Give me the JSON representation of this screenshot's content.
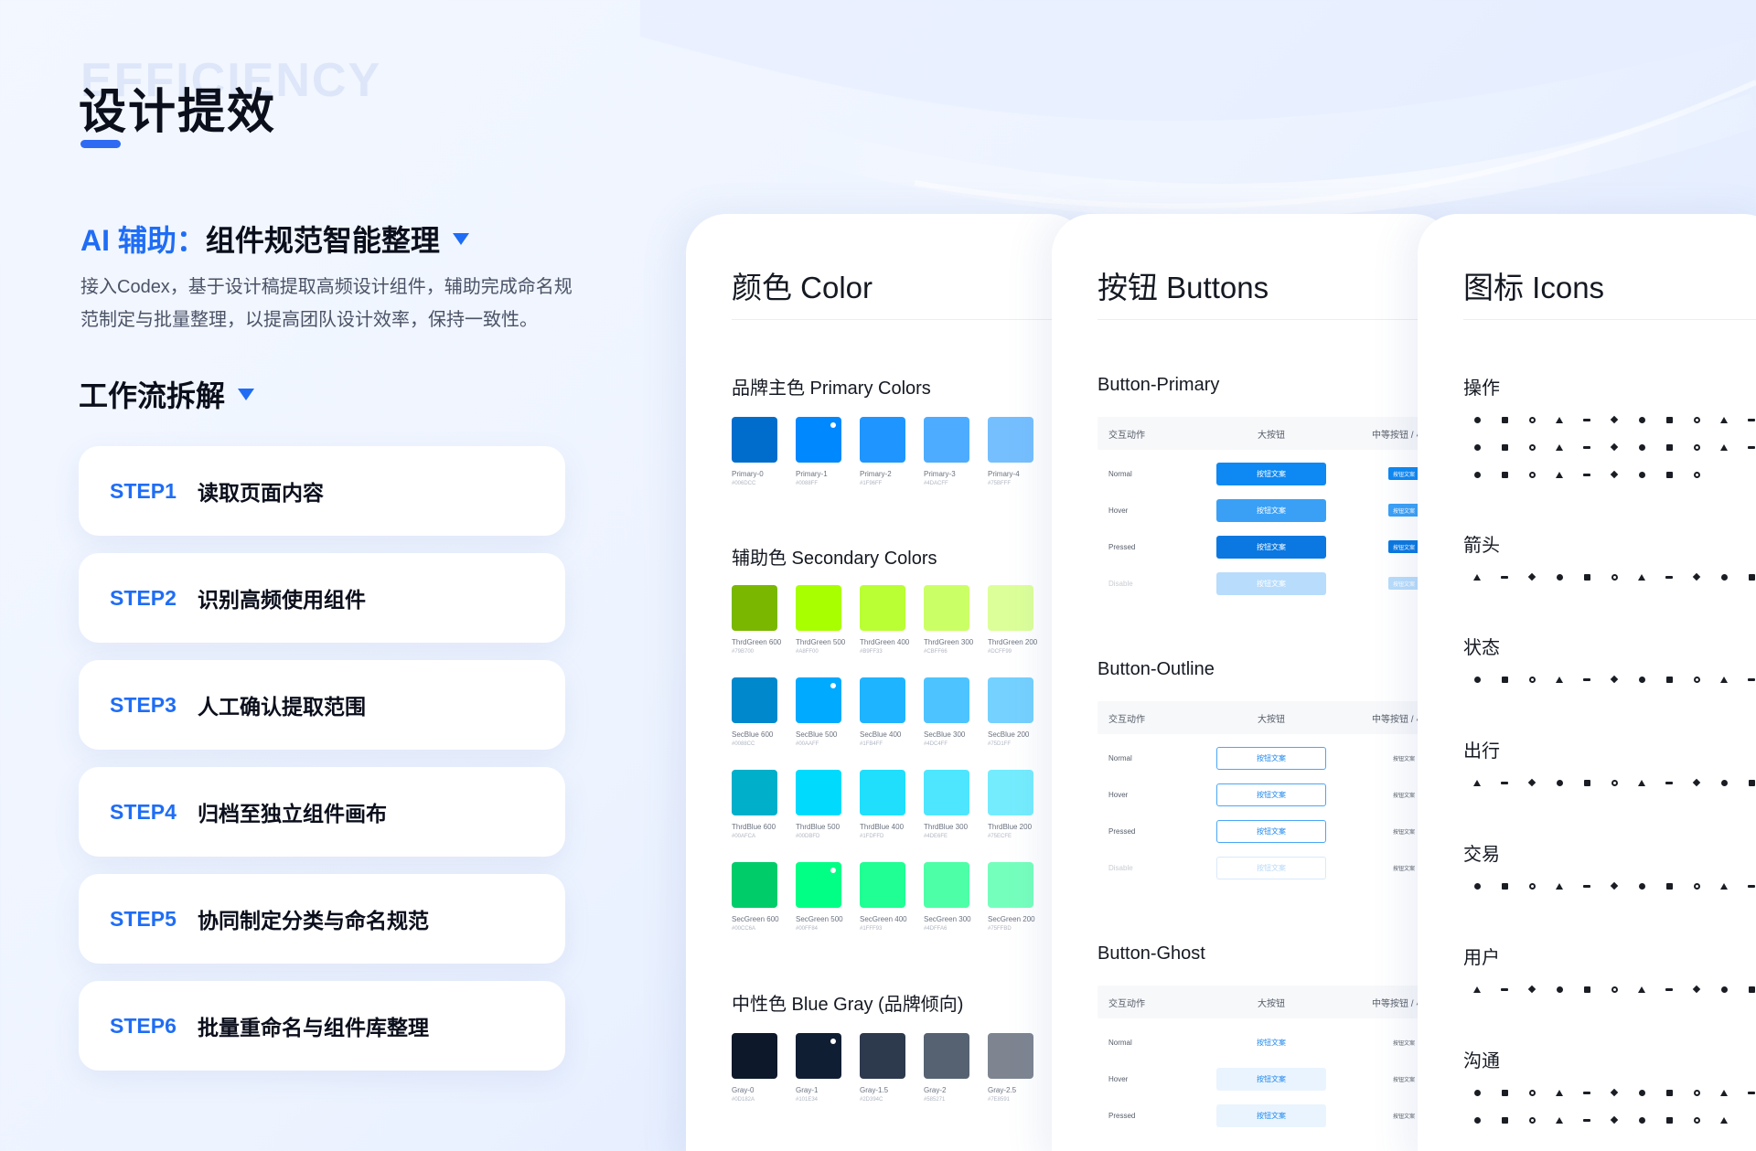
{
  "page": {
    "ghost_word": "EFFICIENCY",
    "title": "设计提效"
  },
  "section": {
    "accent": "AI 辅助：",
    "heading": "组件规范智能整理",
    "description": "接入Codex，基于设计稿提取高频设计组件，辅助完成命名规范制定与批量整理，以提高团队设计效率，保持一致性。"
  },
  "workflow": {
    "heading": "工作流拆解",
    "steps": [
      {
        "num": "STEP1",
        "text": "读取页面内容"
      },
      {
        "num": "STEP2",
        "text": "识别高频使用组件"
      },
      {
        "num": "STEP3",
        "text": "人工确认提取范围"
      },
      {
        "num": "STEP4",
        "text": "归档至独立组件画布"
      },
      {
        "num": "STEP5",
        "text": "协同制定分类与命名规范"
      },
      {
        "num": "STEP6",
        "text": "批量重命名与组件库整理"
      }
    ]
  },
  "color_panel": {
    "title": "颜色 Color",
    "primary_label": "品牌主色 Primary Colors",
    "primary": [
      {
        "name": "Primary-0",
        "hex": "#006DCC",
        "color": "#006DCC"
      },
      {
        "name": "Primary-1",
        "hex": "#0088FF",
        "color": "#0088FF",
        "marked": true
      },
      {
        "name": "Primary-2",
        "hex": "#1F96FF",
        "color": "#1F96FF"
      },
      {
        "name": "Primary-3",
        "hex": "#4DACFF",
        "color": "#4DACFF"
      },
      {
        "name": "Primary-4",
        "hex": "#75BFFF",
        "color": "#75BFFF"
      }
    ],
    "secondary_label": "辅助色 Secondary Colors",
    "secondary_rows": [
      [
        {
          "name": "ThrdGreen 600",
          "hex": "#79B700",
          "color": "#79B700"
        },
        {
          "name": "ThrdGreen 500",
          "hex": "#A8FF00",
          "color": "#A8FF00"
        },
        {
          "name": "ThrdGreen 400",
          "hex": "#B9FF33",
          "color": "#B9FF33"
        },
        {
          "name": "ThrdGreen 300",
          "hex": "#CBFF66",
          "color": "#CBFF66"
        },
        {
          "name": "ThrdGreen 200",
          "hex": "#DCFF99",
          "color": "#DCFF99"
        }
      ],
      [
        {
          "name": "SecBlue 600",
          "hex": "#0088CC",
          "color": "#0088CC"
        },
        {
          "name": "SecBlue 500",
          "hex": "#00AAFF",
          "color": "#00AAFF",
          "marked": true
        },
        {
          "name": "SecBlue 400",
          "hex": "#1FB4FF",
          "color": "#1FB4FF"
        },
        {
          "name": "SecBlue 300",
          "hex": "#4DC4FF",
          "color": "#4DC4FF"
        },
        {
          "name": "SecBlue 200",
          "hex": "#75D1FF",
          "color": "#75D1FF"
        }
      ],
      [
        {
          "name": "ThrdBlue 600",
          "hex": "#00AFCA",
          "color": "#00AFCA"
        },
        {
          "name": "ThrdBlue 500",
          "hex": "#00DBFD",
          "color": "#00DBFD"
        },
        {
          "name": "ThrdBlue 400",
          "hex": "#1FDFFD",
          "color": "#1FDFFD"
        },
        {
          "name": "ThrdBlue 300",
          "hex": "#4DE6FE",
          "color": "#4DE6FE"
        },
        {
          "name": "ThrdBlue 200",
          "hex": "#75ECFE",
          "color": "#75ECFE"
        }
      ],
      [
        {
          "name": "SecGreen 600",
          "hex": "#00CC6A",
          "color": "#00CC6A"
        },
        {
          "name": "SecGreen 500",
          "hex": "#00FF84",
          "color": "#00FF84",
          "marked": true
        },
        {
          "name": "SecGreen 400",
          "hex": "#1FFF93",
          "color": "#1FFF93"
        },
        {
          "name": "SecGreen 300",
          "hex": "#4DFFA6",
          "color": "#4DFFA6"
        },
        {
          "name": "SecGreen 200",
          "hex": "#75FFBD",
          "color": "#75FFBD"
        }
      ]
    ],
    "neutral_label": "中性色 Blue Gray (品牌倾向)",
    "neutral": [
      {
        "name": "Gray-0",
        "hex": "#0D182A",
        "color": "#0D182A"
      },
      {
        "name": "Gray-1",
        "hex": "#101E34",
        "color": "#101E34",
        "marked": true
      },
      {
        "name": "Gray-1.5",
        "hex": "#2D394C",
        "color": "#2D394C"
      },
      {
        "name": "Gray-2",
        "hex": "#585271",
        "color": "#566272"
      },
      {
        "name": "Gray-2.5",
        "hex": "#7E8591",
        "color": "#7E8591"
      }
    ]
  },
  "buttons_panel": {
    "title": "按钮 Buttons",
    "header": [
      "交互动作",
      "大按钮",
      "中等按钮 / 小"
    ],
    "btn_text": "按钮文案",
    "groups": [
      {
        "label": "Button-Primary",
        "style": "primary",
        "states": [
          "Normal",
          "Hover",
          "Pressed",
          "Disable"
        ]
      },
      {
        "label": "Button-Outline",
        "style": "outline",
        "states": [
          "Normal",
          "Hover",
          "Pressed",
          "Disable"
        ]
      },
      {
        "label": "Button-Ghost",
        "style": "ghost",
        "states": [
          "Normal",
          "Hover",
          "Pressed"
        ]
      }
    ],
    "colors": {
      "primary_normal": "#0E88F2",
      "primary_hover": "#3AA0F6",
      "primary_pressed": "#0A78E0",
      "primary_disable": "#B8DCFB",
      "outline_border": "#49A6F7",
      "ghost_fill": "#EAF4FE"
    }
  },
  "icons_panel": {
    "title": "图标 Icons",
    "groups": [
      {
        "label": "操作",
        "rows": 3
      },
      {
        "label": "箭头",
        "rows": 1
      },
      {
        "label": "状态",
        "rows": 1
      },
      {
        "label": "出行",
        "rows": 1
      },
      {
        "label": "交易",
        "rows": 1
      },
      {
        "label": "用户",
        "rows": 1
      },
      {
        "label": "沟通",
        "rows": 2
      }
    ]
  }
}
